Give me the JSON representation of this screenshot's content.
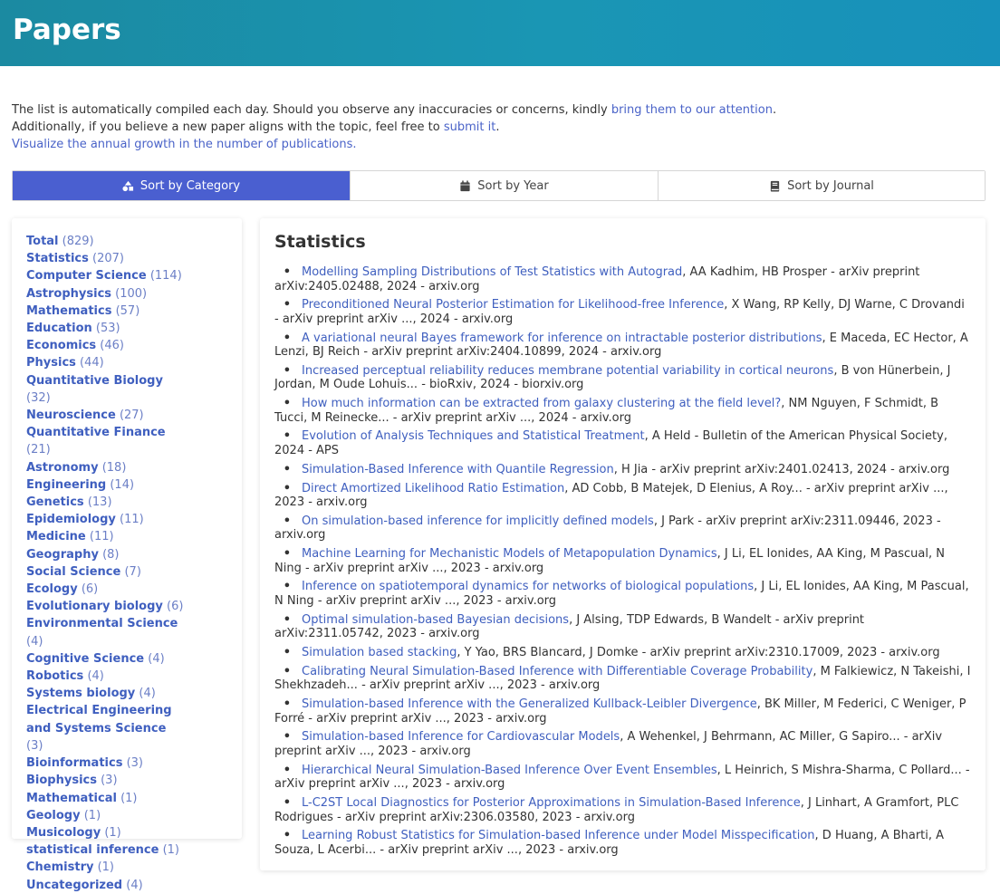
{
  "header": {
    "title": "Papers"
  },
  "intro": {
    "line1_text": "The list is automatically compiled each day. Should you observe any inaccuracies or concerns, kindly ",
    "line1_link": "bring them to our attention",
    "line1_end": ".",
    "line2_text": "Additionally, if you believe a new paper aligns with the topic, feel free to ",
    "line2_link": "submit it",
    "line2_end": ".",
    "line3_link": "Visualize the annual growth in the number of publications."
  },
  "sort": {
    "category": "Sort by Category",
    "year": "Sort by Year",
    "journal": "Sort by Journal",
    "active_color": "#4a5fd0"
  },
  "categories": [
    {
      "name": "Total",
      "count": "(829)"
    },
    {
      "name": "Statistics",
      "count": "(207)"
    },
    {
      "name": "Computer Science",
      "count": "(114)"
    },
    {
      "name": "Astrophysics",
      "count": "(100)"
    },
    {
      "name": "Mathematics",
      "count": "(57)"
    },
    {
      "name": "Education",
      "count": "(53)"
    },
    {
      "name": "Economics",
      "count": "(46)"
    },
    {
      "name": "Physics",
      "count": "(44)"
    },
    {
      "name": "Quantitative Biology",
      "count": "(32)"
    },
    {
      "name": "Neuroscience",
      "count": "(27)"
    },
    {
      "name": "Quantitative Finance",
      "count": "(21)"
    },
    {
      "name": "Astronomy",
      "count": "(18)"
    },
    {
      "name": "Engineering",
      "count": "(14)"
    },
    {
      "name": "Genetics",
      "count": "(13)"
    },
    {
      "name": "Epidemiology",
      "count": "(11)"
    },
    {
      "name": "Medicine",
      "count": "(11)"
    },
    {
      "name": "Geography",
      "count": "(8)"
    },
    {
      "name": "Social Science",
      "count": "(7)"
    },
    {
      "name": "Ecology",
      "count": "(6)"
    },
    {
      "name": "Evolutionary biology",
      "count": "(6)"
    },
    {
      "name": "Environmental Science",
      "count": "(4)"
    },
    {
      "name": "Cognitive Science",
      "count": "(4)"
    },
    {
      "name": "Robotics",
      "count": "(4)"
    },
    {
      "name": "Systems biology",
      "count": "(4)"
    },
    {
      "name": "Electrical Engineering and Systems Science",
      "count": "(3)"
    },
    {
      "name": "Bioinformatics",
      "count": "(3)"
    },
    {
      "name": "Biophysics",
      "count": "(3)"
    },
    {
      "name": "Mathematical",
      "count": "(1)"
    },
    {
      "name": "Geology",
      "count": "(1)"
    },
    {
      "name": "Musicology",
      "count": "(1)"
    },
    {
      "name": "statistical inference",
      "count": "(1)"
    },
    {
      "name": "Chemistry",
      "count": "(1)"
    },
    {
      "name": "Uncategorized",
      "count": "(4)"
    }
  ],
  "main": {
    "heading": "Statistics",
    "papers": [
      {
        "title": "Modelling Sampling Distributions of Test Statistics with Autograd",
        "meta": ", AA Kadhim, HB Prosper - arXiv preprint arXiv:2405.02488, 2024 - arxiv.org"
      },
      {
        "title": "Preconditioned Neural Posterior Estimation for Likelihood-free Inference",
        "meta": ", X Wang, RP Kelly, DJ Warne, C Drovandi - arXiv preprint arXiv ..., 2024 - arxiv.org"
      },
      {
        "title": "A variational neural Bayes framework for inference on intractable posterior distributions",
        "meta": ", E Maceda, EC Hector, A Lenzi, BJ Reich - arXiv preprint arXiv:2404.10899, 2024 - arxiv.org"
      },
      {
        "title": "Increased perceptual reliability reduces membrane potential variability in cortical neurons",
        "meta": ", B von Hünerbein, J Jordan, M Oude Lohuis... - bioRxiv, 2024 - biorxiv.org"
      },
      {
        "title": "How much information can be extracted from galaxy clustering at the field level?",
        "meta": ", NM Nguyen, F Schmidt, B Tucci, M Reinecke... - arXiv preprint arXiv ..., 2024 - arxiv.org"
      },
      {
        "title": "Evolution of Analysis Techniques and Statistical Treatment",
        "meta": ", A Held - Bulletin of the American Physical Society, 2024 - APS"
      },
      {
        "title": "Simulation-Based Inference with Quantile Regression",
        "meta": ", H Jia - arXiv preprint arXiv:2401.02413, 2024 - arxiv.org"
      },
      {
        "title": "Direct Amortized Likelihood Ratio Estimation",
        "meta": ", AD Cobb, B Matejek, D Elenius, A Roy... - arXiv preprint arXiv ..., 2023 - arxiv.org"
      },
      {
        "title": "On simulation-based inference for implicitly defined models",
        "meta": ", J Park - arXiv preprint arXiv:2311.09446, 2023 - arxiv.org"
      },
      {
        "title": "Machine Learning for Mechanistic Models of Metapopulation Dynamics",
        "meta": ", J Li, EL Ionides, AA King, M Pascual, N Ning - arXiv preprint arXiv ..., 2023 - arxiv.org"
      },
      {
        "title": "Inference on spatiotemporal dynamics for networks of biological populations",
        "meta": ", J Li, EL Ionides, AA King, M Pascual, N Ning - arXiv preprint arXiv ..., 2023 - arxiv.org"
      },
      {
        "title": "Optimal simulation-based Bayesian decisions",
        "meta": ", J Alsing, TDP Edwards, B Wandelt - arXiv preprint arXiv:2311.05742, 2023 - arxiv.org"
      },
      {
        "title": "Simulation based stacking",
        "meta": ", Y Yao, BRS Blancard, J Domke - arXiv preprint arXiv:2310.17009, 2023 - arxiv.org"
      },
      {
        "title": "Calibrating Neural Simulation-Based Inference with Differentiable Coverage Probability",
        "meta": ", M Falkiewicz, N Takeishi, I Shekhzadeh... - arXiv preprint arXiv ..., 2023 - arxiv.org"
      },
      {
        "title": "Simulation-based Inference with the Generalized Kullback-Leibler Divergence",
        "meta": ", BK Miller, M Federici, C Weniger, P Forré - arXiv preprint arXiv ..., 2023 - arxiv.org"
      },
      {
        "title": "Simulation-based Inference for Cardiovascular Models",
        "meta": ", A Wehenkel, J Behrmann, AC Miller, G Sapiro... - arXiv preprint arXiv ..., 2023 - arxiv.org"
      },
      {
        "title": "Hierarchical Neural Simulation-Based Inference Over Event Ensembles",
        "meta": ", L Heinrich, S Mishra-Sharma, C Pollard... - arXiv preprint arXiv ..., 2023 - arxiv.org"
      },
      {
        "title": "L-C2ST Local Diagnostics for Posterior Approximations in Simulation-Based Inference",
        "meta": ", J Linhart, A Gramfort, PLC Rodrigues - arXiv preprint arXiv:2306.03580, 2023 - arxiv.org"
      },
      {
        "title": "Learning Robust Statistics for Simulation-based Inference under Model Misspecification",
        "meta": ", D Huang, A Bharti, A Souza, L Acerbi... - arXiv preprint arXiv ..., 2023 - arxiv.org"
      }
    ]
  },
  "icons": {
    "category": "shapes-icon",
    "year": "calendar-icon",
    "journal": "book-icon"
  }
}
